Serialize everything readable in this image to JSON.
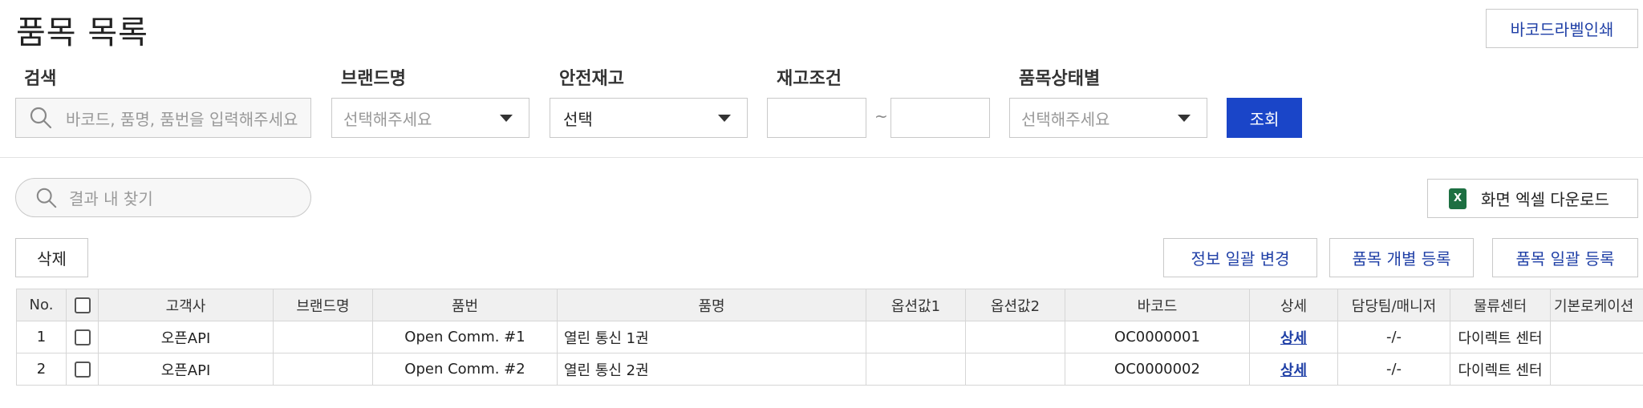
{
  "header": {
    "title": "품목 목록",
    "barcode_label_print": "바코드라벨인쇄"
  },
  "filters": {
    "search": {
      "label": "검색",
      "placeholder": "바코드, 품명, 품번을 입력해주세요"
    },
    "brand": {
      "label": "브랜드명",
      "placeholder": "선택해주세요"
    },
    "safety_stock": {
      "label": "안전재고",
      "value": "선택"
    },
    "stock_condition": {
      "label": "재고조건",
      "separator": "~"
    },
    "item_status": {
      "label": "품목상태별",
      "placeholder": "선택해주세요"
    },
    "query_button": "조회"
  },
  "result_search": {
    "placeholder": "결과 내 찾기"
  },
  "excel_download": "화면 엑셀 다운로드",
  "excel_icon_letter": "X",
  "actions": {
    "delete": "삭제",
    "bulk_info_change": "정보 일괄 변경",
    "single_register": "품목 개별 등록",
    "bulk_register": "품목 일괄 등록"
  },
  "table": {
    "columns": [
      "No.",
      "고객사",
      "브랜드명",
      "품번",
      "품명",
      "옵션값1",
      "옵션값2",
      "바코드",
      "상세",
      "담당팀/매니저",
      "물류센터",
      "기본로케이션"
    ],
    "rows": [
      {
        "no": "1",
        "customer": "오픈API",
        "brand": "",
        "item_no": "Open Comm. #1",
        "item_name": "열린 통신 1권",
        "option1": "",
        "option2": "",
        "barcode": "OC0000001",
        "detail": "상세",
        "manager": "-/-",
        "center": "다이렉트 센터",
        "location": ""
      },
      {
        "no": "2",
        "customer": "오픈API",
        "brand": "",
        "item_no": "Open Comm. #2",
        "item_name": "열린 통신 2권",
        "option1": "",
        "option2": "",
        "barcode": "OC0000002",
        "detail": "상세",
        "manager": "-/-",
        "center": "다이렉트 센터",
        "location": ""
      }
    ]
  },
  "colors": {
    "primary": "#1a45c8",
    "link": "#1f3fa6",
    "excel_green": "#1d6f42"
  }
}
